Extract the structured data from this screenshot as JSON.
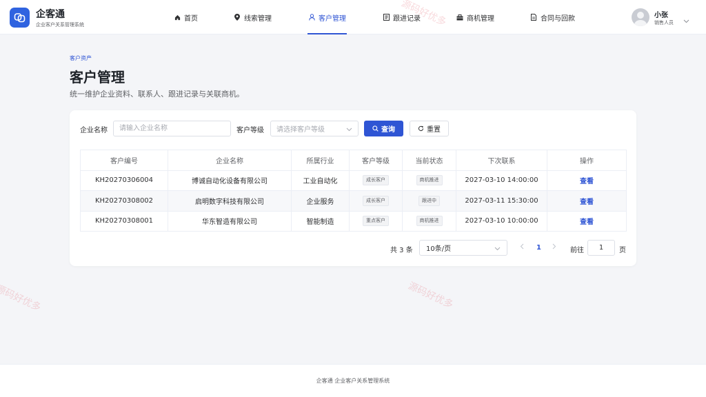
{
  "app": {
    "title": "企客通",
    "subtitle": "企业客户关系管理系统"
  },
  "nav": [
    {
      "label": "首页",
      "icon": "home-icon"
    },
    {
      "label": "线索管理",
      "icon": "location-pin-icon"
    },
    {
      "label": "客户管理",
      "icon": "user-icon",
      "active": true
    },
    {
      "label": "跟进记录",
      "icon": "notebook-icon"
    },
    {
      "label": "商机管理",
      "icon": "briefcase-icon"
    },
    {
      "label": "合同与回款",
      "icon": "document-icon"
    }
  ],
  "user": {
    "name": "小张",
    "role": "销售人员"
  },
  "page": {
    "breadcrumb": "客户资产",
    "title": "客户管理",
    "description": "统一维护企业资料、联系人、跟进记录与关联商机。"
  },
  "filters": {
    "company_label": "企业名称",
    "company_placeholder": "请输入企业名称",
    "level_label": "客户等级",
    "level_placeholder": "请选择客户等级",
    "search_label": "查询",
    "reset_label": "重置"
  },
  "table": {
    "columns": [
      "客户编号",
      "企业名称",
      "所属行业",
      "客户等级",
      "当前状态",
      "下次联系",
      "操作"
    ],
    "rows": [
      {
        "id": "KH20270306004",
        "company": "博诚自动化设备有限公司",
        "industry": "工业自动化",
        "level": "成长客户",
        "status": "商机推进",
        "next_contact": "2027-03-10 14:00:00",
        "action": "查看"
      },
      {
        "id": "KH20270308002",
        "company": "启明数字科技有限公司",
        "industry": "企业服务",
        "level": "成长客户",
        "status": "跟进中",
        "next_contact": "2027-03-11 15:30:00",
        "action": "查看"
      },
      {
        "id": "KH20270308001",
        "company": "华东智造有限公司",
        "industry": "智能制造",
        "level": "重点客户",
        "status": "商机推进",
        "next_contact": "2027-03-10 10:00:00",
        "action": "查看"
      }
    ]
  },
  "pagination": {
    "total_text": "共 3 条",
    "page_size": "10条/页",
    "current_page": "1",
    "goto_label": "前往",
    "goto_value": "1",
    "page_unit": "页"
  },
  "footer": {
    "text": "企客通 企业客户关系管理系统"
  },
  "watermark": "源码好优多",
  "colors": {
    "primary": "#2f55d4",
    "logo": "#2f63e0"
  }
}
